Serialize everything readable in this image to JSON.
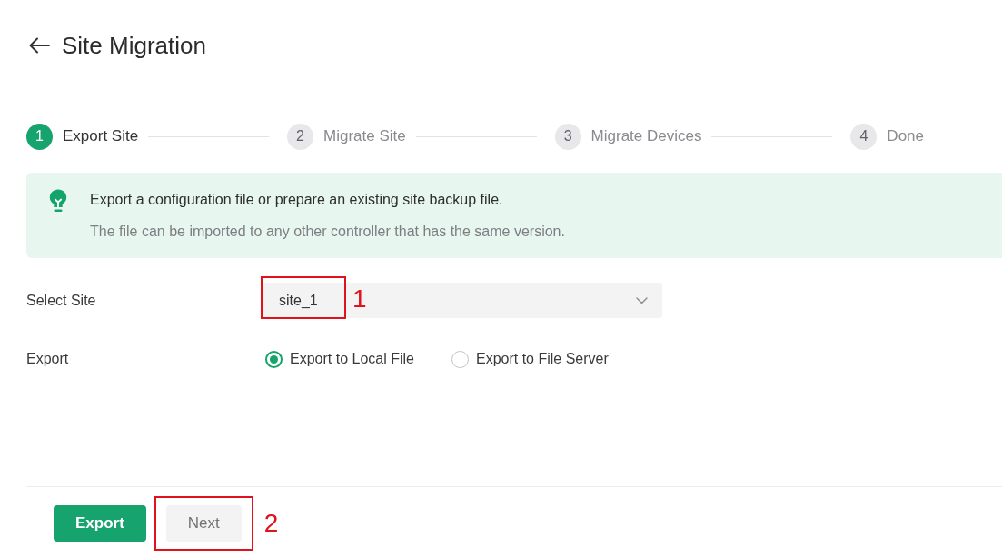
{
  "header": {
    "title": "Site Migration"
  },
  "steps": [
    {
      "number": "1",
      "label": "Export Site",
      "selected": true
    },
    {
      "number": "2",
      "label": "Migrate Site",
      "selected": false
    },
    {
      "number": "3",
      "label": "Migrate Devices",
      "selected": false
    },
    {
      "number": "4",
      "label": "Done",
      "selected": false
    }
  ],
  "info": {
    "heading": "Export a configuration file or prepare an existing site backup file.",
    "text": "The file can be imported to any other controller that has the same version."
  },
  "form": {
    "fields": [
      {
        "kind": "select",
        "label": "Select Site",
        "value": "site_1",
        "callout": "1"
      },
      {
        "kind": "radio",
        "label": "Export",
        "options": [
          {
            "label": "Export to Local File",
            "selected": true
          },
          {
            "label": "Export to File Server",
            "selected": false
          }
        ]
      }
    ]
  },
  "buttons": [
    {
      "label": "Export",
      "disabled": false
    },
    {
      "label": "Next",
      "disabled": true,
      "callout": "2"
    }
  ]
}
